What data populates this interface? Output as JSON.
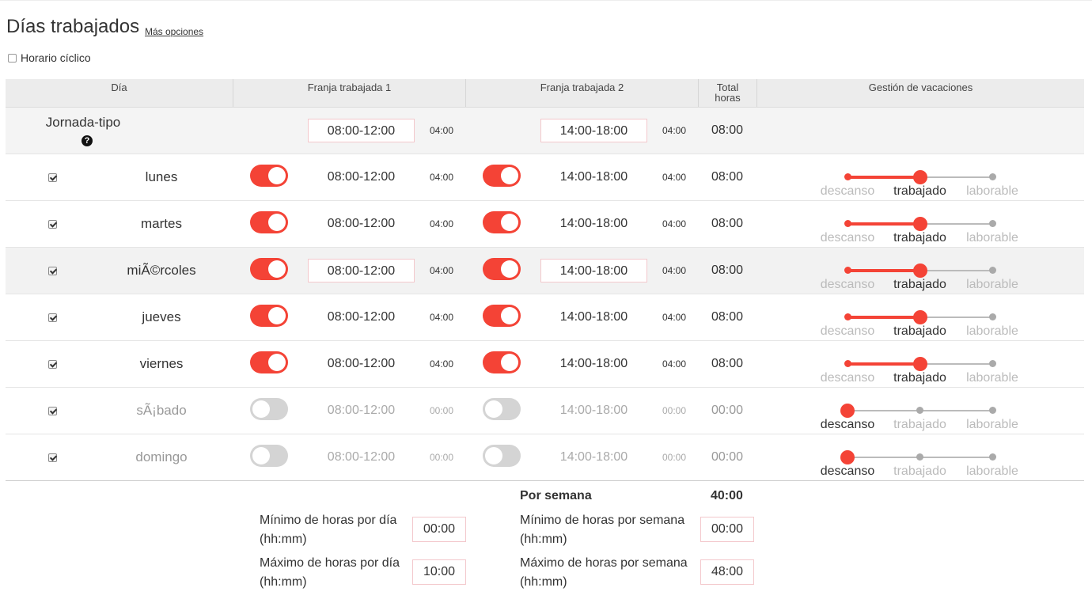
{
  "header": {
    "title": "Días trabajados",
    "more_options": "Más opciones",
    "cyclic_label": "Horario cíclico",
    "cyclic_checked": false
  },
  "columns": {
    "day": "Día",
    "slot1": "Franja trabajada 1",
    "slot2": "Franja trabajada 2",
    "total_line1": "Total",
    "total_line2": "horas",
    "vacation": "Gestión de vacaciones"
  },
  "standard_day": {
    "label": "Jornada-tipo",
    "help_icon": "question-circle-icon",
    "slot1": "08:00-12:00",
    "dur1": "04:00",
    "slot2": "14:00-18:00",
    "dur2": "04:00",
    "total": "08:00"
  },
  "slider_labels": [
    "descanso",
    "trabajado",
    "laborable"
  ],
  "rows": [
    {
      "day": "lunes",
      "checked": true,
      "slot1_on": true,
      "slot1": "08:00-12:00",
      "dur1": "04:00",
      "slot2_on": true,
      "slot2": "14:00-18:00",
      "dur2": "04:00",
      "total": "08:00",
      "vacation": "trabajado"
    },
    {
      "day": "martes",
      "checked": true,
      "slot1_on": true,
      "slot1": "08:00-12:00",
      "dur1": "04:00",
      "slot2_on": true,
      "slot2": "14:00-18:00",
      "dur2": "04:00",
      "total": "08:00",
      "vacation": "trabajado"
    },
    {
      "day": "miÃ©rcoles",
      "checked": true,
      "slot1_on": true,
      "slot1": "08:00-12:00",
      "dur1": "04:00",
      "slot2_on": true,
      "slot2": "14:00-18:00",
      "dur2": "04:00",
      "total": "08:00",
      "vacation": "trabajado"
    },
    {
      "day": "jueves",
      "checked": true,
      "slot1_on": true,
      "slot1": "08:00-12:00",
      "dur1": "04:00",
      "slot2_on": true,
      "slot2": "14:00-18:00",
      "dur2": "04:00",
      "total": "08:00",
      "vacation": "trabajado"
    },
    {
      "day": "viernes",
      "checked": true,
      "slot1_on": true,
      "slot1": "08:00-12:00",
      "dur1": "04:00",
      "slot2_on": true,
      "slot2": "14:00-18:00",
      "dur2": "04:00",
      "total": "08:00",
      "vacation": "trabajado"
    },
    {
      "day": "sÃ¡bado",
      "checked": true,
      "slot1_on": false,
      "slot1": "08:00-12:00",
      "dur1": "00:00",
      "slot2_on": false,
      "slot2": "14:00-18:00",
      "dur2": "00:00",
      "total": "00:00",
      "vacation": "descanso"
    },
    {
      "day": "domingo",
      "checked": true,
      "slot1_on": false,
      "slot1": "08:00-12:00",
      "dur1": "00:00",
      "slot2_on": false,
      "slot2": "14:00-18:00",
      "dur2": "00:00",
      "total": "00:00",
      "vacation": "descanso"
    }
  ],
  "weekly": {
    "label": "Por semana",
    "total": "40:00"
  },
  "limits": {
    "min_day_label": "Mínimo de horas por día",
    "min_day_unit": "(hh:mm)",
    "min_day_value": "00:00",
    "max_day_label": "Máximo de horas por día",
    "max_day_unit": "(hh:mm)",
    "max_day_value": "10:00",
    "min_week_label": "Mínimo de horas por semana",
    "min_week_unit": "(hh:mm)",
    "min_week_value": "00:00",
    "max_week_label": "Máximo de horas por semana",
    "max_week_unit": "(hh:mm)",
    "max_week_value": "48:00"
  },
  "colors": {
    "accent": "#f44336",
    "input_border": "#f3c8cc",
    "header_bg": "#ececec"
  }
}
